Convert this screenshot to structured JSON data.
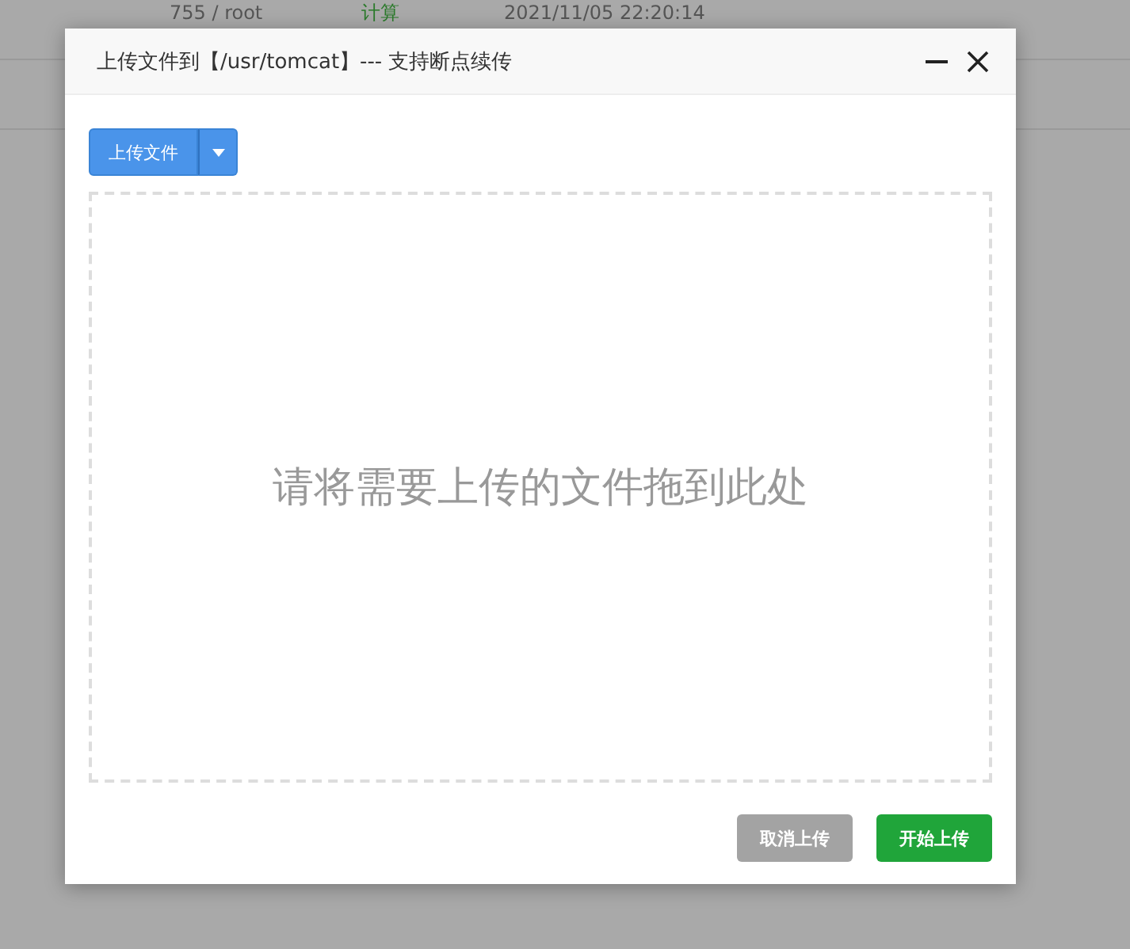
{
  "background_row": {
    "cells": [
      "755 / root",
      "计算",
      "2021/11/05 22:20:14"
    ]
  },
  "dialog": {
    "title": "上传文件到【/usr/tomcat】--- 支持断点续传",
    "upload_button": {
      "label": "上传文件"
    },
    "drop_zone": {
      "text": "请将需要上传的文件拖到此处"
    },
    "buttons": [
      {
        "label": "取消上传",
        "kind": "cancel",
        "disabled": true
      },
      {
        "label": "开始上传",
        "kind": "start",
        "disabled": false
      }
    ]
  }
}
